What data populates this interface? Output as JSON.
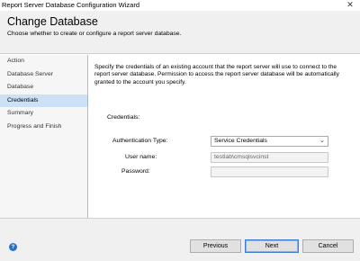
{
  "window": {
    "title": "Report Server Database Configuration Wizard",
    "close_glyph": "✕"
  },
  "header": {
    "title": "Change Database",
    "subtitle": "Choose whether to create or configure a report server database."
  },
  "nav": {
    "items": [
      {
        "label": "Action"
      },
      {
        "label": "Database Server"
      },
      {
        "label": "Database"
      },
      {
        "label": "Credentials"
      },
      {
        "label": "Summary"
      },
      {
        "label": "Progress and Finish"
      }
    ],
    "selected": "Credentials"
  },
  "main": {
    "description": "Specify the credentials of an existing account that the report server will use to connect to the report server database.  Permission to access the report server database will be automatically granted to the account you specify.",
    "credentials_label": "Credentials:",
    "auth_type_label": "Authentication Type:",
    "auth_type_value": "Service Credentials",
    "username_label": "User name:",
    "username_value": "testlab\\cmsqlsvcinst",
    "password_label": "Password:",
    "password_value": ""
  },
  "footer": {
    "help_glyph": "?",
    "previous_label": "Previous",
    "next_label": "Next",
    "cancel_label": "Cancel"
  },
  "colors": {
    "selected_nav_bg": "#cce1f5",
    "header_bg": "#f0f0f0",
    "default_button_border": "#3c7fd4"
  }
}
